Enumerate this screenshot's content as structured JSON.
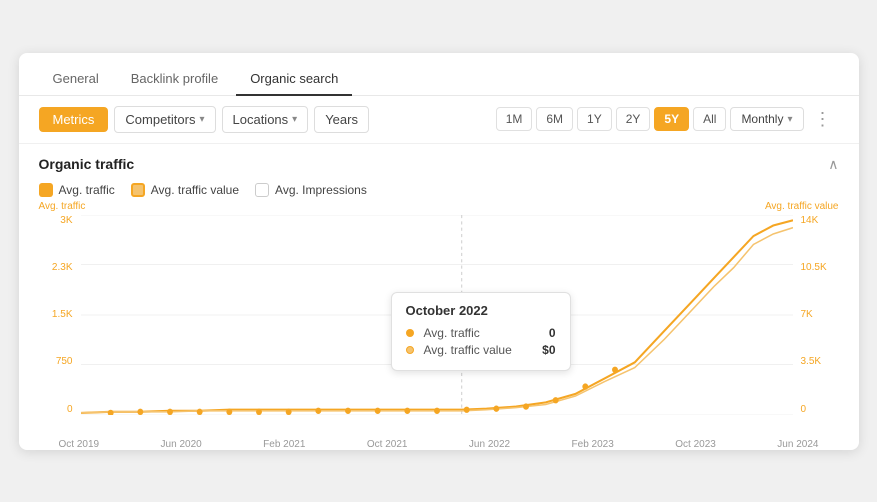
{
  "tabs": [
    {
      "label": "General",
      "active": false
    },
    {
      "label": "Backlink profile",
      "active": false
    },
    {
      "label": "Organic search",
      "active": true
    }
  ],
  "toolbar": {
    "metrics_label": "Metrics",
    "competitors_label": "Competitors",
    "locations_label": "Locations",
    "years_label": "Years",
    "time_buttons": [
      "1M",
      "6M",
      "1Y",
      "2Y",
      "5Y",
      "All"
    ],
    "active_time": "5Y",
    "monthly_label": "Monthly"
  },
  "section": {
    "title": "Organic traffic",
    "avg_traffic_label": "Avg. traffic",
    "avg_traffic_value_label": "Avg. traffic value",
    "avg_impressions_label": "Avg. Impressions"
  },
  "y_axis_left": {
    "label": "Avg. traffic",
    "values": [
      "3K",
      "2.3K",
      "1.5K",
      "750",
      "0"
    ]
  },
  "y_axis_right": {
    "label": "Avg. traffic value",
    "values": [
      "14K",
      "10.5K",
      "7K",
      "3.5K",
      "0"
    ]
  },
  "x_axis": {
    "labels": [
      "Oct 2019",
      "Jun 2020",
      "Feb 2021",
      "Oct 2021",
      "Jun 2022",
      "Feb 2023",
      "Oct 2023",
      "Jun 2024"
    ]
  },
  "tooltip": {
    "title": "October 2022",
    "row1_label": "Avg. traffic",
    "row1_value": "0",
    "row2_label": "Avg. traffic value",
    "row2_value": "$0"
  },
  "colors": {
    "accent": "#f5a623",
    "accent_light": "#f5c36e",
    "active_tab_underline": "#333"
  }
}
